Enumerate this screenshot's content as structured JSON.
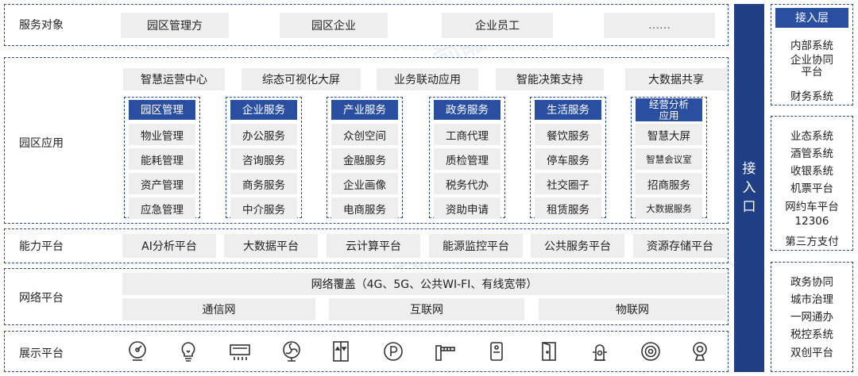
{
  "rows": {
    "service_target": {
      "label": "服务对象",
      "items": [
        "园区管理方",
        "园区企业",
        "企业员工",
        "……"
      ]
    },
    "park_apps": {
      "label": "园区应用",
      "top_items": [
        "智慧运营中心",
        "综态可视化大屏",
        "业务联动应用",
        "智能决策支持",
        "大数据共享"
      ],
      "columns": [
        {
          "head": "园区管理",
          "items": [
            "物业管理",
            "能耗管理",
            "资产管理",
            "应急管理"
          ]
        },
        {
          "head": "企业服务",
          "items": [
            "办公服务",
            "咨询服务",
            "商务服务",
            "中介服务"
          ]
        },
        {
          "head": "产业服务",
          "items": [
            "众创空间",
            "金融服务",
            "企业画像",
            "电商服务"
          ]
        },
        {
          "head": "政务服务",
          "items": [
            "工商代理",
            "质检管理",
            "税务代办",
            "资助申请"
          ]
        },
        {
          "head": "生活服务",
          "items": [
            "餐饮服务",
            "停车服务",
            "社交圈子",
            "租赁服务"
          ]
        },
        {
          "head": "经营分析\n应用",
          "items": [
            "智慧大屏",
            "智慧会议室",
            "招商服务",
            "大数据服务"
          ]
        }
      ]
    },
    "capability": {
      "label": "能力平台",
      "items": [
        "AI分析平台",
        "大数据平台",
        "云计算平台",
        "能源监控平台",
        "公共服务平台",
        "资源存储平台"
      ]
    },
    "network": {
      "label": "网络平台",
      "coverage": "网络覆盖（4G、5G、公共WI-FI、有线宽带）",
      "items": [
        "通信网",
        "互联网",
        "物联网"
      ]
    },
    "display": {
      "label": "展示平台",
      "icons": [
        "gauge-icon",
        "lightbulb-icon",
        "air-conditioner-icon",
        "fan-icon",
        "elevator-icon",
        "parking-icon",
        "barrier-gate-icon",
        "door-lock-icon",
        "door-icon",
        "hydrant-icon",
        "smoke-detector-icon",
        "camera-icon"
      ]
    }
  },
  "access_bar": {
    "chars": [
      "接",
      "入",
      "口"
    ]
  },
  "access_layer": {
    "head": "接入层",
    "items": [
      "内部系统",
      "企业协同\n平台",
      "财务系统"
    ]
  },
  "business_systems": [
    "业态系统",
    "酒管系统",
    "收银系统",
    "机票平台",
    "网约车平台",
    "12306",
    "第三方支付"
  ],
  "gov_systems": [
    "政务协同",
    "城市治理",
    "一网通办",
    "税控系统",
    "双创平台"
  ],
  "colors": {
    "accent": "#2b4fa0",
    "dark_bar": "#213f86",
    "border": "#2b4d8c",
    "box": "#eeeeee"
  }
}
